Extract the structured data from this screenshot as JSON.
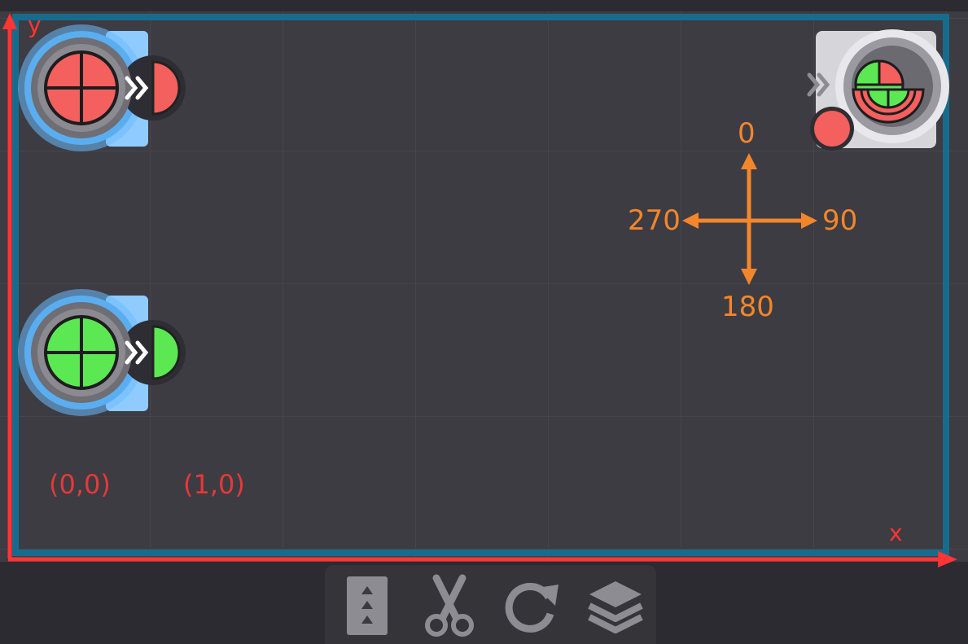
{
  "board": {
    "coordinate_labels": [
      {
        "text": "(0,0)"
      },
      {
        "text": "(1,0)"
      }
    ],
    "axes": {
      "x_label": "x",
      "y_label": "y"
    },
    "direction_legend": {
      "up": "0",
      "right": "90",
      "down": "180",
      "left": "270"
    },
    "pieces": [
      {
        "name": "red-emitter",
        "color": "#f3605e",
        "selected": true
      },
      {
        "name": "green-emitter",
        "color": "#5ce852",
        "selected": true
      },
      {
        "name": "target-receiver",
        "colors": [
          "#f3605e",
          "#5ce852"
        ],
        "selected": false
      }
    ]
  },
  "toolbar": {
    "tools": [
      {
        "name": "layer-order-icon"
      },
      {
        "name": "scissors-icon"
      },
      {
        "name": "rotate-icon"
      },
      {
        "name": "layers-icon"
      }
    ]
  },
  "colors": {
    "board_bg": "#3d3c43",
    "frame": "#176c8e",
    "axis_red": "#ff3434",
    "direction_orange": "#f3862b",
    "red": "#f3605e",
    "green": "#5ce852"
  }
}
